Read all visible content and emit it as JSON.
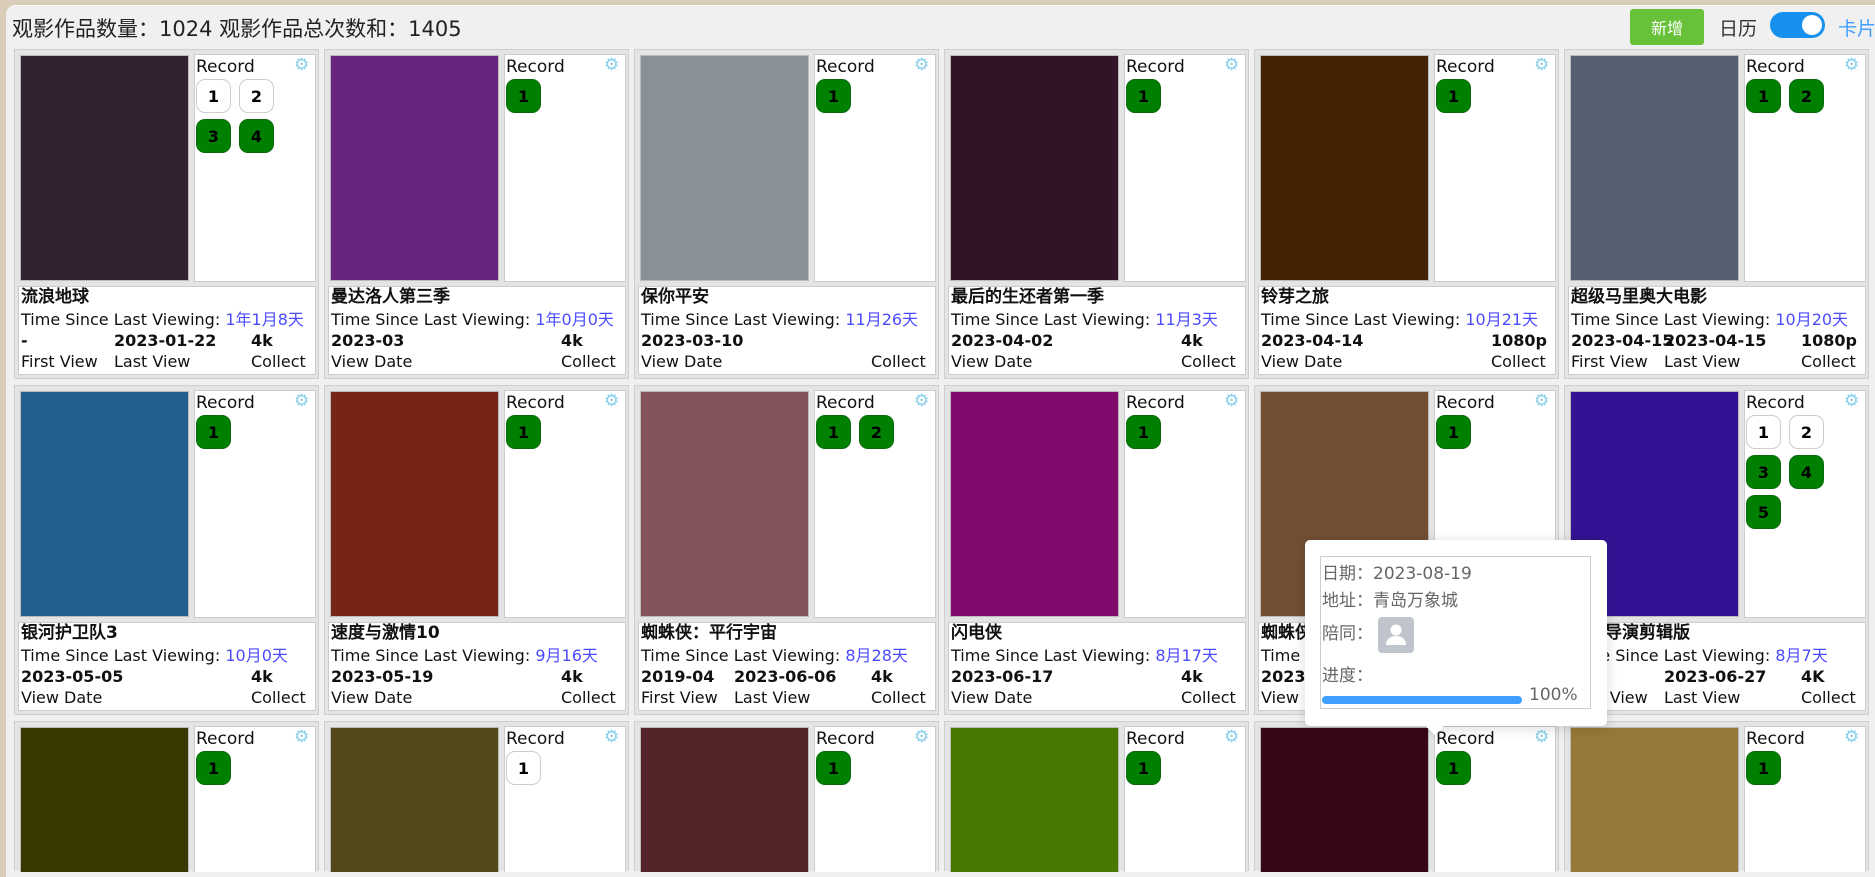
{
  "header": {
    "title": "观影作品数量：1024  观影作品总次数和：1405",
    "add_button": "新增",
    "calendar_label": "日历",
    "card_label": "卡片",
    "view_toggle_on": true
  },
  "record_label": "Record",
  "colors": {
    "done": "#008000",
    "add": "#67c23a",
    "accent": "#409eff",
    "since": "#4b4bff",
    "gear": "#87ceeb"
  },
  "cards": [
    {
      "poster": "#33222f",
      "records": [
        {
          "n": "1",
          "done": false
        },
        {
          "n": "2",
          "done": false
        },
        {
          "n": "3",
          "done": true
        },
        {
          "n": "4",
          "done": true
        }
      ],
      "title": "流浪地球",
      "since_label": "Time Since Last Viewing:",
      "since": "1年1月8天",
      "cols": [
        {
          "v": "-",
          "l": "First View"
        },
        {
          "v": "2023-01-22",
          "l": "Last View"
        }
      ],
      "quality": "4k",
      "quality_label": "Collect"
    },
    {
      "poster": "#67257f",
      "records": [
        {
          "n": "1",
          "done": true
        }
      ],
      "title": "曼达洛人第三季",
      "since_label": "Time Since Last Viewing:",
      "since": "1年0月0天",
      "cols": [
        {
          "v": "2023-03",
          "l": "View Date"
        }
      ],
      "quality": "4k",
      "quality_label": "Collect"
    },
    {
      "poster": "#899097",
      "records": [
        {
          "n": "1",
          "done": true
        }
      ],
      "title": "保你平安",
      "since_label": "Time Since Last Viewing:",
      "since": "11月26天",
      "cols": [
        {
          "v": "2023-03-10",
          "l": "View Date"
        }
      ],
      "quality": "",
      "quality_label": "Collect"
    },
    {
      "poster": "#311428",
      "records": [
        {
          "n": "1",
          "done": true
        }
      ],
      "title": "最后的生还者第一季",
      "since_label": "Time Since Last Viewing:",
      "since": "11月3天",
      "cols": [
        {
          "v": "2023-04-02",
          "l": "View Date"
        }
      ],
      "quality": "4k",
      "quality_label": "Collect"
    },
    {
      "poster": "#432303",
      "records": [
        {
          "n": "1",
          "done": true
        }
      ],
      "title": "铃芽之旅",
      "since_label": "Time Since Last Viewing:",
      "since": "10月21天",
      "cols": [
        {
          "v": "2023-04-14",
          "l": "View Date"
        }
      ],
      "quality": "1080p",
      "quality_label": "Collect"
    },
    {
      "poster": "#546072",
      "records": [
        {
          "n": "1",
          "done": true
        },
        {
          "n": "2",
          "done": true
        }
      ],
      "title": "超级马里奥大电影",
      "since_label": "Time Since Last Viewing:",
      "since": "10月20天",
      "cols": [
        {
          "v": "2023-04-15",
          "l": "First View"
        },
        {
          "v": "2023-04-15",
          "l": "Last View"
        }
      ],
      "quality": "1080p",
      "quality_label": "Collect"
    },
    {
      "poster": "#236090",
      "records": [
        {
          "n": "1",
          "done": true
        }
      ],
      "title": "银河护卫队3",
      "since_label": "Time Since Last Viewing:",
      "since": "10月0天",
      "cols": [
        {
          "v": "2023-05-05",
          "l": "View Date"
        }
      ],
      "quality": "4k",
      "quality_label": "Collect"
    },
    {
      "poster": "#762415",
      "records": [
        {
          "n": "1",
          "done": true
        }
      ],
      "title": "速度与激情10",
      "since_label": "Time Since Last Viewing:",
      "since": "9月16天",
      "cols": [
        {
          "v": "2023-05-19",
          "l": "View Date"
        }
      ],
      "quality": "4k",
      "quality_label": "Collect"
    },
    {
      "poster": "#83525a",
      "records": [
        {
          "n": "1",
          "done": true
        },
        {
          "n": "2",
          "done": true
        }
      ],
      "title": "蜘蛛侠：平行宇宙",
      "since_label": "Time Since Last Viewing:",
      "since": "8月28天",
      "cols": [
        {
          "v": "2019-04",
          "l": "First View"
        },
        {
          "v": "2023-06-06",
          "l": "Last View"
        }
      ],
      "quality": "4k",
      "quality_label": "Collect"
    },
    {
      "poster": "#820a6d",
      "records": [
        {
          "n": "1",
          "done": true
        }
      ],
      "title": "闪电侠",
      "since_label": "Time Since Last Viewing:",
      "since": "8月17天",
      "cols": [
        {
          "v": "2023-06-17",
          "l": "View Date"
        }
      ],
      "quality": "4k",
      "quality_label": "Collect"
    },
    {
      "poster": "#724f33",
      "records": [
        {
          "n": "1",
          "done": true
        }
      ],
      "title": "蜘蛛侠",
      "since_label": "Time Since Last Viewing:",
      "since": "",
      "cols": [
        {
          "v": "2023-",
          "l": "View Date"
        }
      ],
      "quality": "",
      "quality_label": ""
    },
    {
      "poster": "#331393",
      "records": [
        {
          "n": "1",
          "done": false
        },
        {
          "n": "2",
          "done": false
        },
        {
          "n": "3",
          "done": true
        },
        {
          "n": "4",
          "done": true
        },
        {
          "n": "5",
          "done": true
        }
      ],
      "title": "联盟导演剪辑版",
      "since_label": "Time Since Last Viewing:",
      "since": "8月7天",
      "cols": [
        {
          "v": "",
          "l": "First View"
        },
        {
          "v": "2023-06-27",
          "l": "Last View"
        }
      ],
      "quality": "4K",
      "quality_label": "Collect"
    },
    {
      "poster": "#393802",
      "records": [
        {
          "n": "1",
          "done": true
        }
      ]
    },
    {
      "poster": "#534819",
      "records": [
        {
          "n": "1",
          "done": false
        }
      ]
    },
    {
      "poster": "#542428",
      "records": [
        {
          "n": "1",
          "done": true
        }
      ]
    },
    {
      "poster": "#477800",
      "records": [
        {
          "n": "1",
          "done": true
        }
      ]
    },
    {
      "poster": "#370617",
      "records": [
        {
          "n": "1",
          "done": true
        }
      ]
    },
    {
      "poster": "#967838",
      "records": [
        {
          "n": "1",
          "done": true
        }
      ]
    }
  ],
  "tooltip": {
    "date_label": "日期：",
    "date": "2023-08-19",
    "address_label": "地址：",
    "address": "青岛万象城",
    "companion_label": "陪同：",
    "progress_label": "进度：",
    "progress_percent": 100,
    "progress_text": "100%"
  }
}
